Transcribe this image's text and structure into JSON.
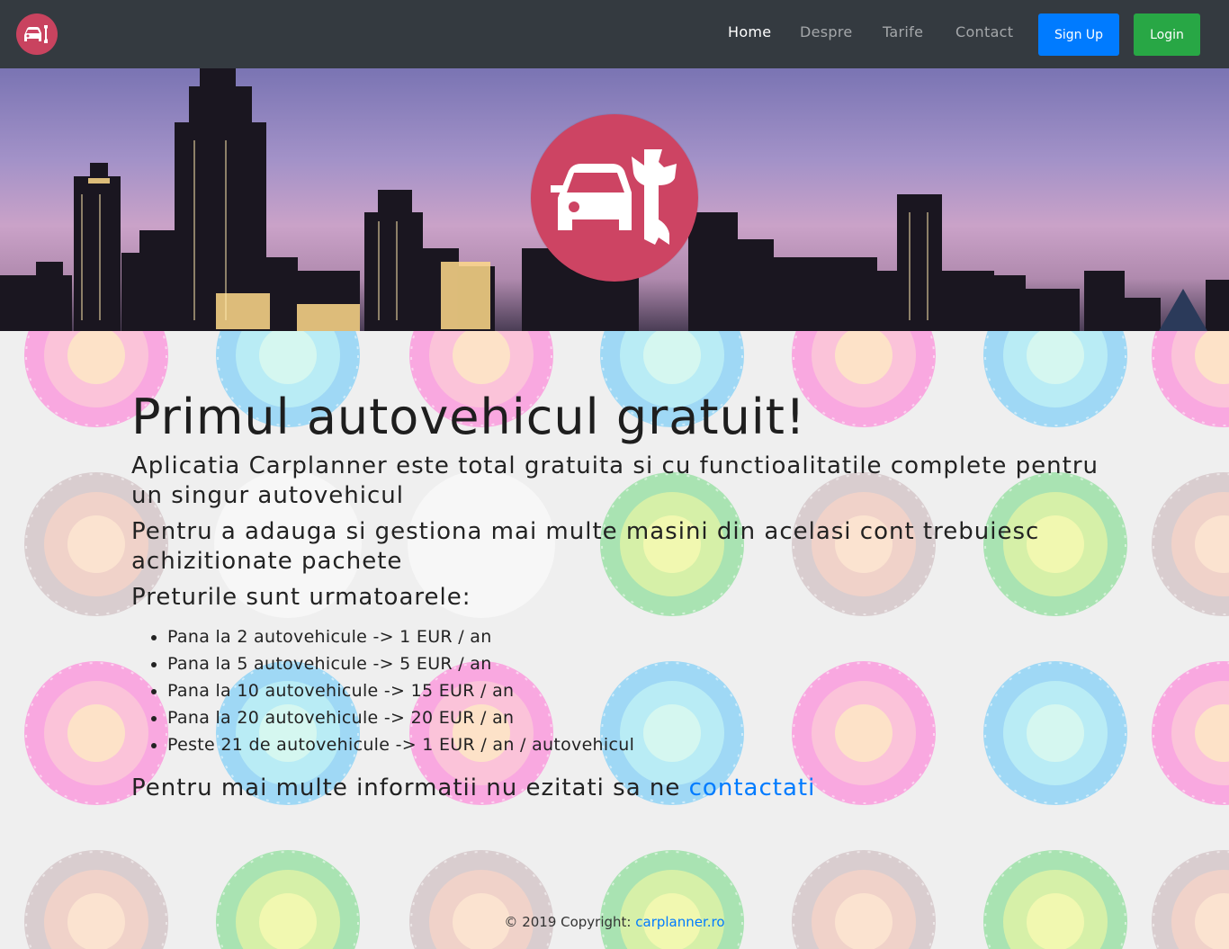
{
  "navbar": {
    "logo_icon": "car-wrench-icon",
    "links": [
      {
        "label": "Home",
        "active": true
      },
      {
        "label": "Despre",
        "active": false
      },
      {
        "label": "Tarife",
        "active": false
      },
      {
        "label": "Contact",
        "active": false
      }
    ],
    "signup_label": "Sign Up",
    "login_label": "Login"
  },
  "hero": {
    "logo_icon": "car-wrench-icon"
  },
  "main": {
    "headline": "Primul autovehicul gratuit!",
    "paragraphs": [
      "Aplicatia Carplanner este total gratuita si cu functioalitatile complete pentru un singur autovehicul",
      "Pentru a adauga si gestiona mai multe masini din acelasi cont trebuiesc achizitionate pachete",
      "Preturile sunt urmatoarele:"
    ],
    "prices": [
      "Pana la 2 autovehicule -> 1 EUR / an",
      "Pana la 5 autovehicule -> 5 EUR / an",
      "Pana la 10 autovehicule -> 15 EUR / an",
      "Pana la 20 autovehicule -> 20 EUR / an",
      "Peste 21 de autovehicule -> 1 EUR / an / autovehicul"
    ],
    "contact_prefix": "Pentru mai multe informatii nu ezitati sa ne ",
    "contact_link": "contactati"
  },
  "footer": {
    "prefix": "© 2019 Copyright: ",
    "link": "carplanner.ro"
  },
  "colors": {
    "navbar_bg": "#343a40",
    "brand_red": "#cd4463",
    "primary": "#007bff",
    "success": "#28a745"
  }
}
